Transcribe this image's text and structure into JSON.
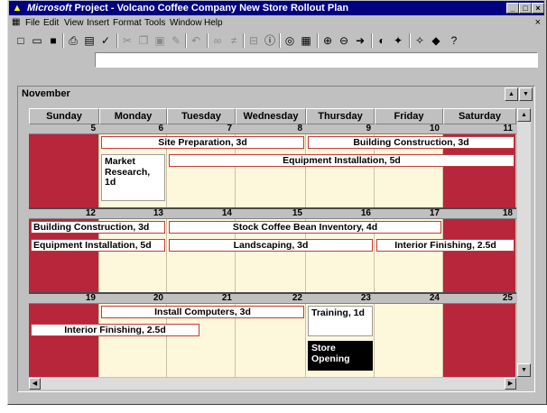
{
  "window": {
    "title_brand": "Microsoft",
    "title_rest": " Project - Volcano Coffee Company New Store Rollout Plan",
    "controls": [
      "_",
      "□",
      "×"
    ]
  },
  "menu": {
    "items": [
      "File",
      "Edit",
      "View",
      "Insert",
      "Format",
      "Tools",
      "Window",
      "Help"
    ]
  },
  "toolbar": {
    "buttons": [
      {
        "name": "new-icon",
        "glyph": "□"
      },
      {
        "name": "open-icon",
        "glyph": "▭"
      },
      {
        "name": "save-icon",
        "glyph": "■"
      },
      {
        "name": "print-icon",
        "glyph": "⎙"
      },
      {
        "name": "print-preview-icon",
        "glyph": "▤"
      },
      {
        "name": "spelling-icon",
        "glyph": "✓"
      },
      {
        "name": "cut-icon",
        "glyph": "✂"
      },
      {
        "name": "copy-icon",
        "glyph": "❐"
      },
      {
        "name": "paste-icon",
        "glyph": "▣"
      },
      {
        "name": "format-painter-icon",
        "glyph": "✎"
      },
      {
        "name": "undo-icon",
        "glyph": "↶"
      },
      {
        "name": "link-tasks-icon",
        "glyph": "∞"
      },
      {
        "name": "unlink-tasks-icon",
        "glyph": "≠"
      },
      {
        "name": "split-task-icon",
        "glyph": "⊟"
      },
      {
        "name": "task-info-icon",
        "glyph": "ⓘ"
      },
      {
        "name": "notes-icon",
        "glyph": "◎"
      },
      {
        "name": "assign-resources-icon",
        "glyph": "▦"
      },
      {
        "name": "zoom-in-icon",
        "glyph": "⊕"
      },
      {
        "name": "zoom-out-icon",
        "glyph": "⊖"
      },
      {
        "name": "goto-task-icon",
        "glyph": "➜"
      },
      {
        "name": "copy-picture-icon",
        "glyph": "◐"
      },
      {
        "name": "gantt-wizard-icon",
        "glyph": "✦"
      },
      {
        "name": "web-toolbar-icon",
        "glyph": "✧"
      },
      {
        "name": "hyperlink-icon",
        "glyph": "◆"
      },
      {
        "name": "help-icon",
        "glyph": "?"
      }
    ]
  },
  "entry_bar": {
    "value": ""
  },
  "calendar": {
    "month": "November",
    "days_of_week": [
      "Sunday",
      "Monday",
      "Tuesday",
      "Wednesday",
      "Thursday",
      "Friday",
      "Saturday"
    ],
    "weeks": [
      {
        "days": [
          "5",
          "6",
          "7",
          "8",
          "9",
          "10",
          "11"
        ],
        "tasks": [
          {
            "label": "Site Preparation, 3d",
            "col": 1,
            "span": 3,
            "row": 0
          },
          {
            "label": "Building Construction, 3d",
            "col": 4,
            "span": 3,
            "row": 0
          },
          {
            "label": "Equipment Installation, 5d",
            "col": 2,
            "span": 5,
            "row": 1
          },
          {
            "label": "Market Research, 1d",
            "col": 1,
            "span": 1,
            "row": 1,
            "tall": true
          }
        ]
      },
      {
        "days": [
          "12",
          "13",
          "14",
          "15",
          "16",
          "17",
          "18"
        ],
        "tasks": [
          {
            "label": "Building Construction, 3d",
            "col": 0,
            "span": 2,
            "row": 0,
            "left": true
          },
          {
            "label": "Stock Coffee Bean Inventory, 4d",
            "col": 2,
            "span": 4,
            "row": 0
          },
          {
            "label": "Equipment Installation, 5d",
            "col": 0,
            "span": 2,
            "row": 1,
            "left": true
          },
          {
            "label": "Landscaping, 3d",
            "col": 2,
            "span": 3,
            "row": 1
          },
          {
            "label": "Interior Finishing, 2.5d",
            "col": 5,
            "span": 2,
            "row": 1
          }
        ]
      },
      {
        "days": [
          "19",
          "20",
          "21",
          "22",
          "23",
          "24",
          "25"
        ],
        "tasks": [
          {
            "label": "Install Computers, 3d",
            "col": 1,
            "span": 3,
            "row": 0
          },
          {
            "label": "Interior Finishing, 2.5d",
            "col": 0,
            "span": 2.5,
            "row": 1
          },
          {
            "label": "Training, 1d",
            "col": 4,
            "span": 1,
            "row": 0,
            "tall": true
          },
          {
            "label": "Store Opening",
            "col": 4,
            "span": 1,
            "row": 2,
            "tall": true,
            "black": true
          }
        ]
      }
    ]
  },
  "colors": {
    "titlebar": "#000080",
    "weekend": "#b8263c",
    "day_background": "#fdf8dc",
    "task_border": "#c43a3a"
  }
}
